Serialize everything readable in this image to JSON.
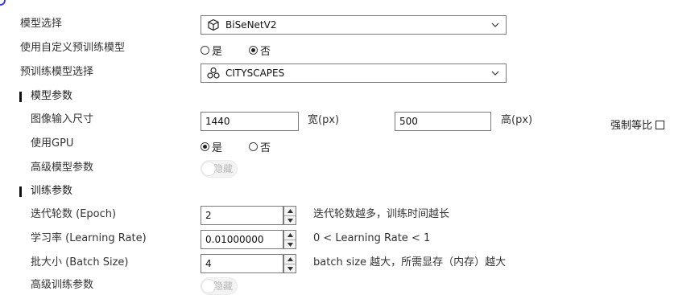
{
  "model": {
    "label": "模型选择",
    "selected": "BiSeNetV2",
    "icon": "cube-icon"
  },
  "custom_pretrained": {
    "label": "使用自定义预训练模型",
    "options": [
      "是",
      "否"
    ],
    "selected": "否"
  },
  "pretrained": {
    "label": "预训练模型选择",
    "selected": "CITYSCAPES",
    "icon": "cluster-icon"
  },
  "model_params": {
    "section_title": "模型参数",
    "image_size": {
      "label": "图像输入尺寸",
      "width_value": "1440",
      "width_unit": "宽(px)",
      "height_value": "500",
      "height_unit": "高(px)",
      "lock_ratio_label": "强制等比"
    },
    "use_gpu": {
      "label": "使用GPU",
      "options": [
        "是",
        "否"
      ],
      "selected": "是"
    },
    "advanced": {
      "label": "高级模型参数",
      "toggle_label": "隐藏"
    }
  },
  "train_params": {
    "section_title": "训练参数",
    "epoch": {
      "label": "迭代轮数 (Epoch)",
      "value": "2",
      "hint": "迭代轮数越多，训练时间越长"
    },
    "learning_rate": {
      "label": "学习率 (Learning Rate)",
      "value": "0.01000000",
      "hint": "0 < Learning Rate < 1"
    },
    "batch_size": {
      "label": "批大小 (Batch Size)",
      "value": "4",
      "hint": "batch size 越大，所需显存（内存）越大"
    },
    "advanced": {
      "label": "高级训练参数",
      "toggle_label": "隐藏"
    }
  },
  "colors": {
    "accent": "#3b3fe0",
    "border": "#7a7a7a"
  }
}
